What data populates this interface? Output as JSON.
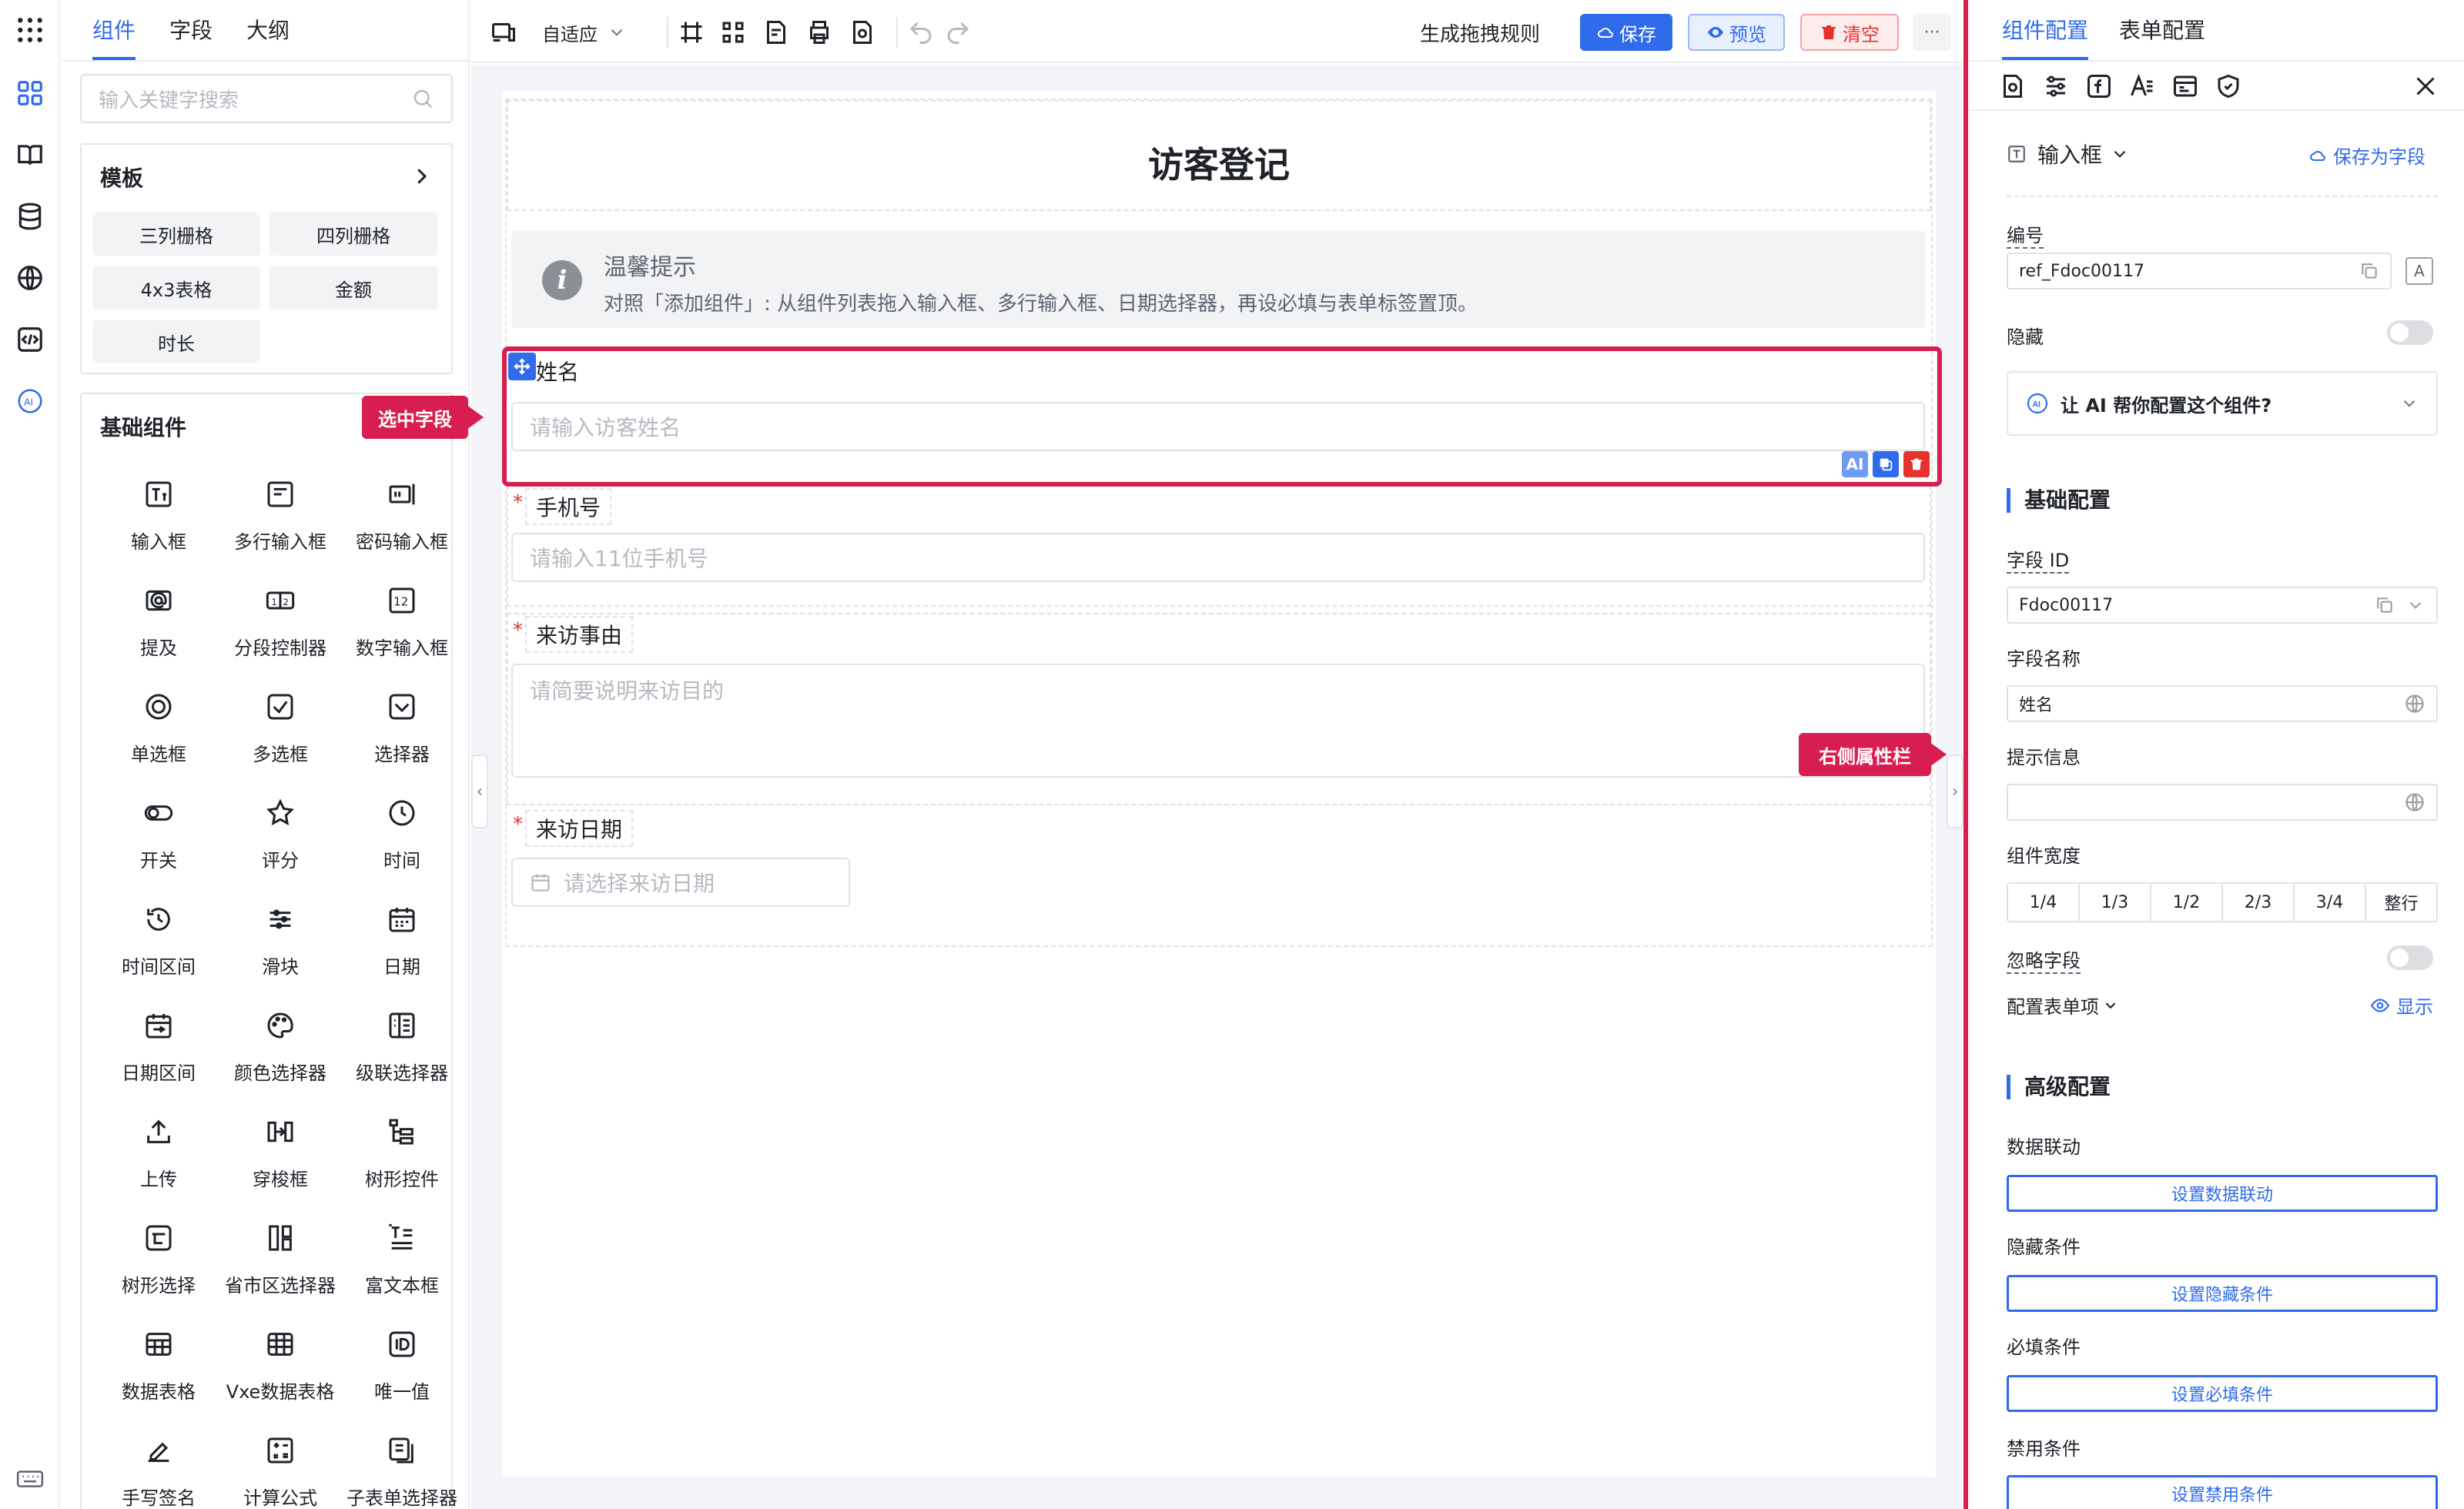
{
  "left_panel": {
    "tabs": [
      "组件",
      "字段",
      "大纲"
    ],
    "search_placeholder": "输入关键字搜索",
    "templates": {
      "title": "模板",
      "items": [
        "三列栅格",
        "四列栅格",
        "4x3表格",
        "金额",
        "时长"
      ]
    },
    "basic": {
      "title": "基础组件",
      "items": [
        {
          "label": "输入框",
          "icon": "input-icon"
        },
        {
          "label": "多行输入框",
          "icon": "textarea-icon"
        },
        {
          "label": "密码输入框",
          "icon": "password-icon"
        },
        {
          "label": "提及",
          "icon": "mention-icon"
        },
        {
          "label": "分段控制器",
          "icon": "segmented-icon"
        },
        {
          "label": "数字输入框",
          "icon": "number-icon"
        },
        {
          "label": "单选框",
          "icon": "radio-icon"
        },
        {
          "label": "多选框",
          "icon": "checkbox-icon"
        },
        {
          "label": "选择器",
          "icon": "select-icon"
        },
        {
          "label": "开关",
          "icon": "switch-icon"
        },
        {
          "label": "评分",
          "icon": "star-icon"
        },
        {
          "label": "时间",
          "icon": "clock-icon"
        },
        {
          "label": "时间区间",
          "icon": "time-range-icon"
        },
        {
          "label": "滑块",
          "icon": "slider-icon"
        },
        {
          "label": "日期",
          "icon": "calendar-icon"
        },
        {
          "label": "日期区间",
          "icon": "date-range-icon"
        },
        {
          "label": "颜色选择器",
          "icon": "palette-icon"
        },
        {
          "label": "级联选择器",
          "icon": "cascader-icon"
        },
        {
          "label": "上传",
          "icon": "upload-icon"
        },
        {
          "label": "穿梭框",
          "icon": "transfer-icon"
        },
        {
          "label": "树形控件",
          "icon": "tree-icon"
        },
        {
          "label": "树形选择",
          "icon": "tree-select-icon"
        },
        {
          "label": "省市区选择器",
          "icon": "region-icon"
        },
        {
          "label": "富文本框",
          "icon": "richtext-icon"
        },
        {
          "label": "数据表格",
          "icon": "table-icon"
        },
        {
          "label": "Vxe数据表格",
          "icon": "vxe-table-icon"
        },
        {
          "label": "唯一值",
          "icon": "id-icon"
        },
        {
          "label": "手写签名",
          "icon": "signature-icon"
        },
        {
          "label": "计算公式",
          "icon": "formula-icon"
        },
        {
          "label": "子表单选择器",
          "icon": "subform-icon"
        }
      ]
    }
  },
  "toolbar": {
    "adapt_label": "自适应",
    "gen_rules": "生成拖拽规则",
    "save": "保存",
    "preview": "预览",
    "clear": "清空",
    "more": "···"
  },
  "form": {
    "title": "访客登记",
    "notice_title": "温馨提示",
    "notice_text": "对照「添加组件」: 从组件列表拖入输入框、多行输入框、日期选择器，再设必填与表单标签置顶。",
    "fields": [
      {
        "label": "姓名",
        "placeholder": "请输入访客姓名",
        "required": false
      },
      {
        "label": "手机号",
        "placeholder": "请输入11位手机号",
        "required": true
      },
      {
        "label": "来访事由",
        "placeholder": "请简要说明来访目的",
        "required": true
      },
      {
        "label": "来访日期",
        "placeholder": "请选择来访日期",
        "required": true
      }
    ],
    "selected_actions": [
      "AI",
      "",
      ""
    ]
  },
  "callouts": {
    "selected": "选中字段",
    "right_panel": "右侧属性栏"
  },
  "right_panel": {
    "tabs": [
      "组件配置",
      "表单配置"
    ],
    "component_type": "输入框",
    "save_as_field": "保存为字段",
    "ref_label": "编号",
    "ref_value": "ref_Fdoc00117",
    "hidden_label": "隐藏",
    "ai_prompt": "让 AI 帮你配置这个组件?",
    "basic_title": "基础配置",
    "field_id_label": "字段 ID",
    "field_id_value": "Fdoc00117",
    "field_name_label": "字段名称",
    "field_name_value": "姓名",
    "hint_label": "提示信息",
    "hint_value": "",
    "width_label": "组件宽度",
    "width_options": [
      "1/4",
      "1/3",
      "1/2",
      "2/3",
      "3/4",
      "整行"
    ],
    "ignore_label": "忽略字段",
    "config_items_label": "配置表单项",
    "show_label": "显示",
    "advanced_title": "高级配置",
    "linkage_label": "数据联动",
    "linkage_btn": "设置数据联动",
    "hide_cond_label": "隐藏条件",
    "hide_cond_btn": "设置隐藏条件",
    "req_cond_label": "必填条件",
    "req_cond_btn": "设置必填条件",
    "disable_cond_label": "禁用条件",
    "disable_cond_btn": "设置禁用条件"
  },
  "colors": {
    "accent": "#2f6bea",
    "highlight": "#d81e50",
    "required": "#e5322d"
  }
}
